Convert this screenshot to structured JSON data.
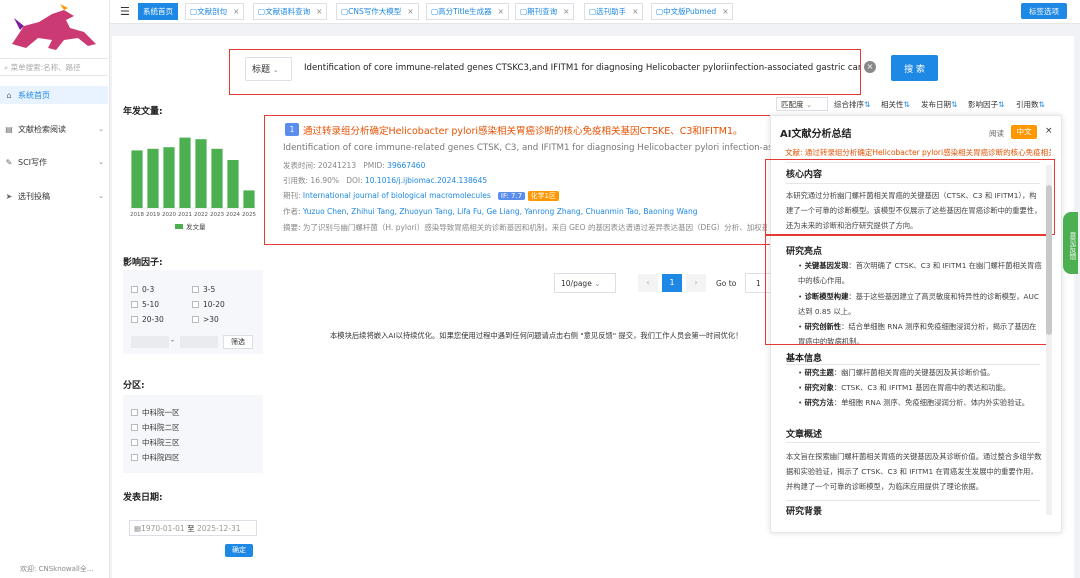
{
  "sidebar": {
    "search_placeholder": "菜单搜索:名称、路径",
    "menu": [
      {
        "label": "系统首页",
        "icon": "home-icon"
      },
      {
        "label": "文献检索阅读",
        "icon": "document-icon"
      },
      {
        "label": "SCI写作",
        "icon": "pen-icon"
      },
      {
        "label": "选刊投稿",
        "icon": "send-icon"
      }
    ],
    "footer": "欢迎: CNSknowall全..."
  },
  "tabs": [
    {
      "label": "系统首页",
      "active": true
    },
    {
      "label": "文献剖句"
    },
    {
      "label": "文献语料查询"
    },
    {
      "label": "CNS写作大模型"
    },
    {
      "label": "高分Title生成器"
    },
    {
      "label": "期刊查询"
    },
    {
      "label": "选刊助手"
    },
    {
      "label": "中文版Pubmed"
    }
  ],
  "tag_options": "标签选项",
  "search": {
    "field": "标题",
    "query": "Identification of core immune-related genes CTSKC3,and IFITM1 for diagnosing Helicobacter pyloriinfection-associated gastric cancer",
    "button": "搜 索"
  },
  "sort": {
    "match": "匹配度",
    "options": [
      "综合排序",
      "相关性",
      "发布日期",
      "影响因子",
      "引用数"
    ]
  },
  "year_chart": {
    "title": "年发文量:",
    "legend": "发文量"
  },
  "chart_data": {
    "type": "bar",
    "categories": [
      "2018",
      "2019",
      "2020",
      "2021",
      "2022",
      "2023",
      "2024",
      "2025"
    ],
    "series": [
      {
        "name": "发文量",
        "values": [
          72,
          74,
          76,
          88,
          86,
          74,
          60,
          22
        ]
      }
    ],
    "ylim": [
      0,
      100
    ]
  },
  "impact_filter": {
    "title": "影响因子:",
    "options": [
      "0-3",
      "3-5",
      "5-10",
      "10-20",
      "20-30",
      ">30"
    ],
    "dash": "-",
    "button": "筛选"
  },
  "zone_filter": {
    "title": "分区:",
    "options": [
      "中科院一区",
      "中科院二区",
      "中科院三区",
      "中科院四区"
    ]
  },
  "date_filter": {
    "title": "发表日期:",
    "start": "1970-01-01",
    "to": "至",
    "end": "2025-12-31",
    "button": "确定"
  },
  "result": {
    "index": "1",
    "title_cn": "通过转录组分析确定Helicobacter pylori感染相关胃癌诊断的核心免疫相关基因CTSKE、C3和IFITM1。",
    "title_en": "Identification of core immune-related genes CTSK, C3, and IFITM1 for diagnosing Helicobacter pylori infection-associated gastric cancer through transcriptomic analysis",
    "pub_label": "发表时间:",
    "pub_date": "20241213",
    "pmid_label": "PMID:",
    "pmid": "39667460",
    "cite_label": "引用数:",
    "cite": "16.90%",
    "doi_label": "DOI:",
    "doi": "10.1016/j.ijbiomac.2024.138645",
    "journal_label": "期刊:",
    "journal": "International journal of biological macromolecules",
    "if_badge": "IF: 7.7",
    "zone_badge": "化学1区",
    "author_label": "作者:",
    "authors": [
      "Yuzuo Chen",
      "Zhihui Tang",
      "Zhuoyun Tang",
      "Lifa Fu",
      "Ge Liang",
      "Yanrong Zhang",
      "Chuanmin Tao",
      "Baoning Wang"
    ],
    "abstract_label": "摘要:",
    "abstract": "为了识别与幽门螺杆菌（H. pylori）感染导致胃癌相关的诊断基因和机制，来自 GEO 的基因表达谱通过差异表达基因（DEG）分析、加权基因共表达网络分析"
  },
  "pager": {
    "size": "10/page",
    "current": "1",
    "goto": "Go to",
    "goto_value": "1"
  },
  "notice": "本模块后续将嵌入AI以持续优化。如果您使用过程中遇到任何问题请点击右侧 \"意见反馈\" 提交，我们工作人员会第一时间优化！",
  "ai_panel": {
    "title": "AI文献分析总结",
    "read": "阅读",
    "lang": "中文",
    "close": "×",
    "subtitle": "文献: 通过转录组分析确定Helicobacter pylori感染相关胃癌诊断的核心免疫相关基因",
    "core_title": "核心内容",
    "core_text": "本研究通过分析幽门螺杆菌相关胃癌的关键基因（CTSK、C3 和 IFITM1），构建了一个可靠的诊断模型。该模型不仅展示了这些基因在胃癌诊断中的重要性，还为未来的诊断和治疗研究提供了方向。",
    "highlights_title": "研究亮点",
    "highlights": [
      {
        "k": "关键基因发现",
        "v": "首次明确了 CTSK、C3 和 IFITM1 在幽门螺杆菌相关胃癌中的核心作用。"
      },
      {
        "k": "诊断模型构建",
        "v": "基于这些基因建立了高灵敏度和特异性的诊断模型，AUC 达到 0.85 以上。"
      },
      {
        "k": "研究创新性",
        "v": "结合单细胞 RNA 测序和免疫细胞浸润分析，揭示了基因在胃癌中的致病机制。"
      }
    ],
    "basic_title": "基本信息",
    "basic": [
      {
        "k": "研究主题",
        "v": "幽门螺杆菌相关胃癌的关键基因及其诊断价值。"
      },
      {
        "k": "研究对象",
        "v": "CTSK、C3 和 IFITM1 基因在胃癌中的表达和功能。"
      },
      {
        "k": "研究方法",
        "v": "单细胞 RNA 测序、免疫细胞浸润分析、体内外实验验证。"
      }
    ],
    "overview_title": "文章概述",
    "overview_text": "本文旨在探索幽门螺杆菌相关胃癌的关键基因及其诊断价值。通过整合多组学数据和实验验证，揭示了 CTSK、C3 和 IFITM1 在胃癌发生发展中的重要作用，并构建了一个可靠的诊断模型，为临床应用提供了理论依据。",
    "background_title": "研究背景"
  },
  "feedback": "意见反馈"
}
